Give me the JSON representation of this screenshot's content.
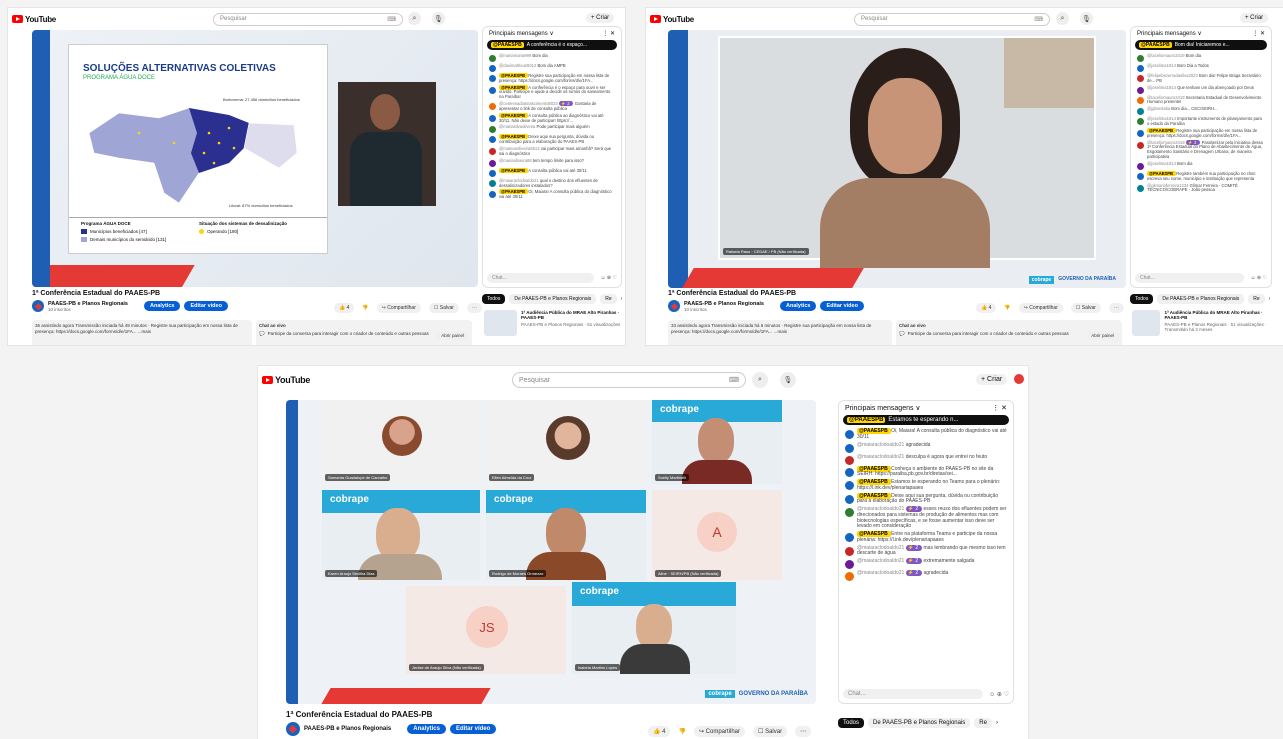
{
  "colors": {
    "yt_red": "#ff0000",
    "blue": "#065fd4",
    "accent_red": "#e53935",
    "cobrape": "#29a9d8"
  },
  "common": {
    "logo": "YouTube",
    "search_placeholder": "Pesquisar",
    "create": "+ Criar",
    "title": "1ª Conferência Estadual do PAAES-PB",
    "channel": "PAAES-PB e Planos Regionais",
    "analytics": "Analytics",
    "edit": "Editar vídeo",
    "likes": "4",
    "share": "Compartilhar",
    "save": "Salvar",
    "chat_header": "Principais mensagens ∨",
    "chat_placeholder": "Chat...",
    "tab_all": "Todos",
    "tab_channel": "De PAAES-PB e Planos Regionais",
    "tab_more": "Re"
  },
  "shot1": {
    "subs": "10 inscritos",
    "slide": {
      "title": "SOLUÇÕES ALTERNATIVAS COLETIVAS",
      "subtitle": "PROGRAMA ÁGUA DOCE",
      "note1": "Borborema: 27.456 domicílios beneficiados",
      "note2": "Litoral: 87% domicílios beneficiados",
      "leg_title": "Programa ÁGUA DOCE",
      "leg1": "Municípios beneficiados [47]",
      "leg2": "Demais municípios do semiárido [131]",
      "sit_title": "Situação dos sistemas de dessalinização",
      "sit1": "Operando [180]"
    },
    "pinned": "A conferência é o espaço...",
    "messages": [
      {
        "user": "@mariamaria999",
        "text": "Bom dia"
      },
      {
        "user": "@davimatheus5012",
        "text": "Bom dia AMPB"
      },
      {
        "user": "@PAAESPB",
        "text": "Registre sua participação em nossa lista de presença: https://docs.google.com/forms/d/e/1FA...",
        "tag": true
      },
      {
        "user": "@PAAESPB",
        "text": "A conferência é o espaço para ouvir e ser ouvido. Participe e ajude a decidir os rumos do saneamento na Paraíba!",
        "tag": true
      },
      {
        "user": "@ceteresadiasnascimento8023",
        "text": "Gostaria de apresentar o link de consulta pública",
        "badge": "⚡ 2"
      },
      {
        "user": "@PAAESPB",
        "text": "A consulta pública ao diagnóstico vai até 30/11. Não deixe de participar! https://...",
        "tag": true
      },
      {
        "user": "@mariasilvaoliveira",
        "text": "Pode participar mais alguém"
      },
      {
        "user": "@PAAESPB",
        "text": "Deixe aqui sua pergunta, dúvida ou contribuição para a elaboração do PAAES-PB",
        "tag": true
      },
      {
        "user": "@mateusoliveira5512",
        "text": "vai participar mais amanhã? Será que sai o diagnóstico"
      },
      {
        "user": "@mariaoliveira88",
        "text": "tem tempo limite para isso?"
      },
      {
        "user": "@PAAESPB",
        "text": "A consulta pública vai até 30/11",
        "tag": true
      },
      {
        "user": "@maiaraclodoaldo21",
        "text": "qual o destino dos efluentes de dessalinizadores instalados?"
      },
      {
        "user": "@PAAESPB",
        "text": "Oi, Maiara! A consulta pública do diagnóstico vai até 30/11",
        "tag": true
      }
    ],
    "tabs_item": "1ª Audiência Pública do MRAE Alto Piranhas · PAAES-PB",
    "tabs_meta": "PAAES-PB e Planos Regionais · 51 visualizações",
    "desc": "36 assistindo agora  Transmissão iniciada há 49 minutos · Registre sua participação em nossa lista de presença: https://docs.google.com/forms/d/e/1FA... ...mais",
    "live_chat": "Chat ao vivo",
    "live_chat_text": "Participe da conversa para interagir com o criador de conteúdo e outras pessoas",
    "live_chat_btn": "Abrir painel"
  },
  "shot2": {
    "subs": "10 inscritos",
    "pinned": "Bom dia! Iniciaremos e...",
    "messages": [
      {
        "user": "@taceliomauro2419",
        "text": "Bom dia"
      },
      {
        "user": "@joselima1814",
        "text": "Bom Dia a Todos"
      },
      {
        "user": "@felipebezerradasilva2023",
        "text": "Bom dia! Felipe Braga Secretário de... PB"
      },
      {
        "user": "@joselima1814",
        "text": "Que tenham um dia abençoado por Deus"
      },
      {
        "user": "@taceliomauro2419",
        "text": "Secretaria Estadual de Desenvolvimento Humano presente!"
      },
      {
        "user": "@jgbenitalia",
        "text": "Bom dia... CEC/SEIRH..."
      },
      {
        "user": "@joselima1814",
        "text": "Importante instrumento de planejamento para o estado da Paraíba"
      },
      {
        "user": "@PAAESPB",
        "text": "Registre sua participação em nossa lista de presença: https://docs.google.com/forms/d/e/1FA...",
        "tag": true
      },
      {
        "user": "@taceliomauro2419",
        "text": "Parabenizar pela iniciativa dessa 1ª Conferência Estadual do Plano de Abastecimento de Água, Esgotamento Sanitário e Drenagem Urbana, de maneira participativa",
        "badge": "⚡ 2"
      },
      {
        "user": "@joselima1814",
        "text": "Bom dia"
      },
      {
        "user": "@PAAESPB",
        "text": "Registre também sua participação no chat: escreva seu nome, município e instituição que representa",
        "tag": true
      },
      {
        "user": "@glimarioferreira1234",
        "text": "Glimar Ferreira · COMITÊ TÉCNICO/COBRAPE · João pessoa"
      }
    ],
    "tabs_item": "1ª Audiência Pública do MRAE Alto Piranhas · PAAES-PB",
    "tabs_meta": "PAAES-PB e Planos Regionais · 51 visualizações · Transmitido há 2 meses",
    "desc": "33 assistindo agora  Transmissão iniciada há 6 minutos · Registre sua participação em nossa lista de presença: https://docs.google.com/forms/d/e/1FA... ...mais",
    "live_chat": "Chat ao vivo",
    "live_chat_text": "Participe da conversa para interagir com o criador de conteúdo e outras pessoas",
    "live_chat_btn": "Abrir painel",
    "cam_label": "Rafaela Raso · CEDAE / PB (Não verificada)"
  },
  "shot3": {
    "pinned": "Estamos te esperando n...",
    "messages": [
      {
        "user": "@PAAESPB",
        "text": "Oi, Maiara! A consulta pública do diagnóstico vai até 30/11",
        "tag": true
      },
      {
        "user": "@maiaraclodoaldo21",
        "text": "agradecida"
      },
      {
        "user": "@maiaraclodoaldo21",
        "text": "desculpa é agora que entrei no feuto"
      },
      {
        "user": "@PAAESPB",
        "text": "Conheça o ambiente do PAAES-PB no site da SEIRH: https://paraiba.pb.gov.br/diretas/sei...",
        "tag": true
      },
      {
        "user": "@PAAESPB",
        "text": "Estamos te esperando no Teams para o plenário: https://l.ink.dev/plenariapaaes",
        "tag": true
      },
      {
        "user": "@PAAESPB",
        "text": "Deixe aqui sua pergunta, dúvida ou contribuição para a elaboração do PAAES-PB",
        "tag": true
      },
      {
        "user": "@maiaraclodoaldo21",
        "text": "esses reuso dos efluentes podem ser direcionados para sistemas de produção de alimentos mas com biotecnologias específicas, e se fosse aumentar isso deve ser levado em consideração",
        "badge": "⚡ 2"
      },
      {
        "user": "@PAAESPB",
        "text": "Entre na plataforma Teams e participe da nossa plenária: https://l.ink.dev/plenariapaaes",
        "tag": true
      },
      {
        "user": "@maiaraclodoaldo21",
        "text": "mas lembrando que mesmo isso tem descarte de água",
        "badge": "⚡ 2"
      },
      {
        "user": "@maiaraclodoaldo21",
        "text": "extremamente salgada",
        "badge": "⚡ 2"
      },
      {
        "user": "@maiaraclodoaldo21",
        "text": "agradecida",
        "badge": "⚡ 2"
      }
    ],
    "tiles": [
      {
        "label": "Samanta Guadalupe de Carvalho"
      },
      {
        "label": "Ellen Almeida da Cruz"
      },
      {
        "label": "Suelly Martinelli"
      },
      {
        "label": "Karen Araujo Sevilha Dias"
      },
      {
        "label": "Rodrigo de Moraes Ormezzo"
      },
      {
        "label": "Aline · SEIRH/PB (Não verificada)",
        "initial": "A"
      },
      {
        "label": "Jenise de Araujo Silva (Não verificada)",
        "initial": "JS"
      },
      {
        "label": "Isabela Martins Lopes"
      }
    ],
    "cobrape": "cobrape",
    "gov": "GOVERNO DA PARAÍBA"
  }
}
